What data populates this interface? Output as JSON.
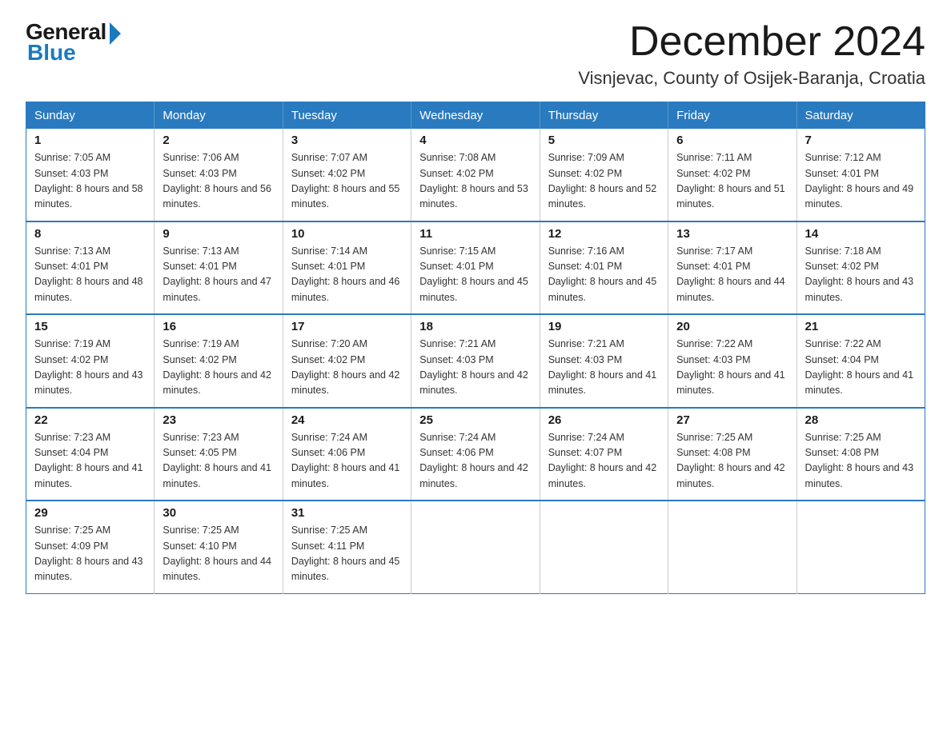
{
  "logo": {
    "general": "General",
    "blue": "Blue"
  },
  "title": "December 2024",
  "location": "Visnjevac, County of Osijek-Baranja, Croatia",
  "days_of_week": [
    "Sunday",
    "Monday",
    "Tuesday",
    "Wednesday",
    "Thursday",
    "Friday",
    "Saturday"
  ],
  "weeks": [
    [
      {
        "day": 1,
        "sunrise": "7:05 AM",
        "sunset": "4:03 PM",
        "daylight": "8 hours and 58 minutes."
      },
      {
        "day": 2,
        "sunrise": "7:06 AM",
        "sunset": "4:03 PM",
        "daylight": "8 hours and 56 minutes."
      },
      {
        "day": 3,
        "sunrise": "7:07 AM",
        "sunset": "4:02 PM",
        "daylight": "8 hours and 55 minutes."
      },
      {
        "day": 4,
        "sunrise": "7:08 AM",
        "sunset": "4:02 PM",
        "daylight": "8 hours and 53 minutes."
      },
      {
        "day": 5,
        "sunrise": "7:09 AM",
        "sunset": "4:02 PM",
        "daylight": "8 hours and 52 minutes."
      },
      {
        "day": 6,
        "sunrise": "7:11 AM",
        "sunset": "4:02 PM",
        "daylight": "8 hours and 51 minutes."
      },
      {
        "day": 7,
        "sunrise": "7:12 AM",
        "sunset": "4:01 PM",
        "daylight": "8 hours and 49 minutes."
      }
    ],
    [
      {
        "day": 8,
        "sunrise": "7:13 AM",
        "sunset": "4:01 PM",
        "daylight": "8 hours and 48 minutes."
      },
      {
        "day": 9,
        "sunrise": "7:13 AM",
        "sunset": "4:01 PM",
        "daylight": "8 hours and 47 minutes."
      },
      {
        "day": 10,
        "sunrise": "7:14 AM",
        "sunset": "4:01 PM",
        "daylight": "8 hours and 46 minutes."
      },
      {
        "day": 11,
        "sunrise": "7:15 AM",
        "sunset": "4:01 PM",
        "daylight": "8 hours and 45 minutes."
      },
      {
        "day": 12,
        "sunrise": "7:16 AM",
        "sunset": "4:01 PM",
        "daylight": "8 hours and 45 minutes."
      },
      {
        "day": 13,
        "sunrise": "7:17 AM",
        "sunset": "4:01 PM",
        "daylight": "8 hours and 44 minutes."
      },
      {
        "day": 14,
        "sunrise": "7:18 AM",
        "sunset": "4:02 PM",
        "daylight": "8 hours and 43 minutes."
      }
    ],
    [
      {
        "day": 15,
        "sunrise": "7:19 AM",
        "sunset": "4:02 PM",
        "daylight": "8 hours and 43 minutes."
      },
      {
        "day": 16,
        "sunrise": "7:19 AM",
        "sunset": "4:02 PM",
        "daylight": "8 hours and 42 minutes."
      },
      {
        "day": 17,
        "sunrise": "7:20 AM",
        "sunset": "4:02 PM",
        "daylight": "8 hours and 42 minutes."
      },
      {
        "day": 18,
        "sunrise": "7:21 AM",
        "sunset": "4:03 PM",
        "daylight": "8 hours and 42 minutes."
      },
      {
        "day": 19,
        "sunrise": "7:21 AM",
        "sunset": "4:03 PM",
        "daylight": "8 hours and 41 minutes."
      },
      {
        "day": 20,
        "sunrise": "7:22 AM",
        "sunset": "4:03 PM",
        "daylight": "8 hours and 41 minutes."
      },
      {
        "day": 21,
        "sunrise": "7:22 AM",
        "sunset": "4:04 PM",
        "daylight": "8 hours and 41 minutes."
      }
    ],
    [
      {
        "day": 22,
        "sunrise": "7:23 AM",
        "sunset": "4:04 PM",
        "daylight": "8 hours and 41 minutes."
      },
      {
        "day": 23,
        "sunrise": "7:23 AM",
        "sunset": "4:05 PM",
        "daylight": "8 hours and 41 minutes."
      },
      {
        "day": 24,
        "sunrise": "7:24 AM",
        "sunset": "4:06 PM",
        "daylight": "8 hours and 41 minutes."
      },
      {
        "day": 25,
        "sunrise": "7:24 AM",
        "sunset": "4:06 PM",
        "daylight": "8 hours and 42 minutes."
      },
      {
        "day": 26,
        "sunrise": "7:24 AM",
        "sunset": "4:07 PM",
        "daylight": "8 hours and 42 minutes."
      },
      {
        "day": 27,
        "sunrise": "7:25 AM",
        "sunset": "4:08 PM",
        "daylight": "8 hours and 42 minutes."
      },
      {
        "day": 28,
        "sunrise": "7:25 AM",
        "sunset": "4:08 PM",
        "daylight": "8 hours and 43 minutes."
      }
    ],
    [
      {
        "day": 29,
        "sunrise": "7:25 AM",
        "sunset": "4:09 PM",
        "daylight": "8 hours and 43 minutes."
      },
      {
        "day": 30,
        "sunrise": "7:25 AM",
        "sunset": "4:10 PM",
        "daylight": "8 hours and 44 minutes."
      },
      {
        "day": 31,
        "sunrise": "7:25 AM",
        "sunset": "4:11 PM",
        "daylight": "8 hours and 45 minutes."
      },
      null,
      null,
      null,
      null
    ]
  ]
}
